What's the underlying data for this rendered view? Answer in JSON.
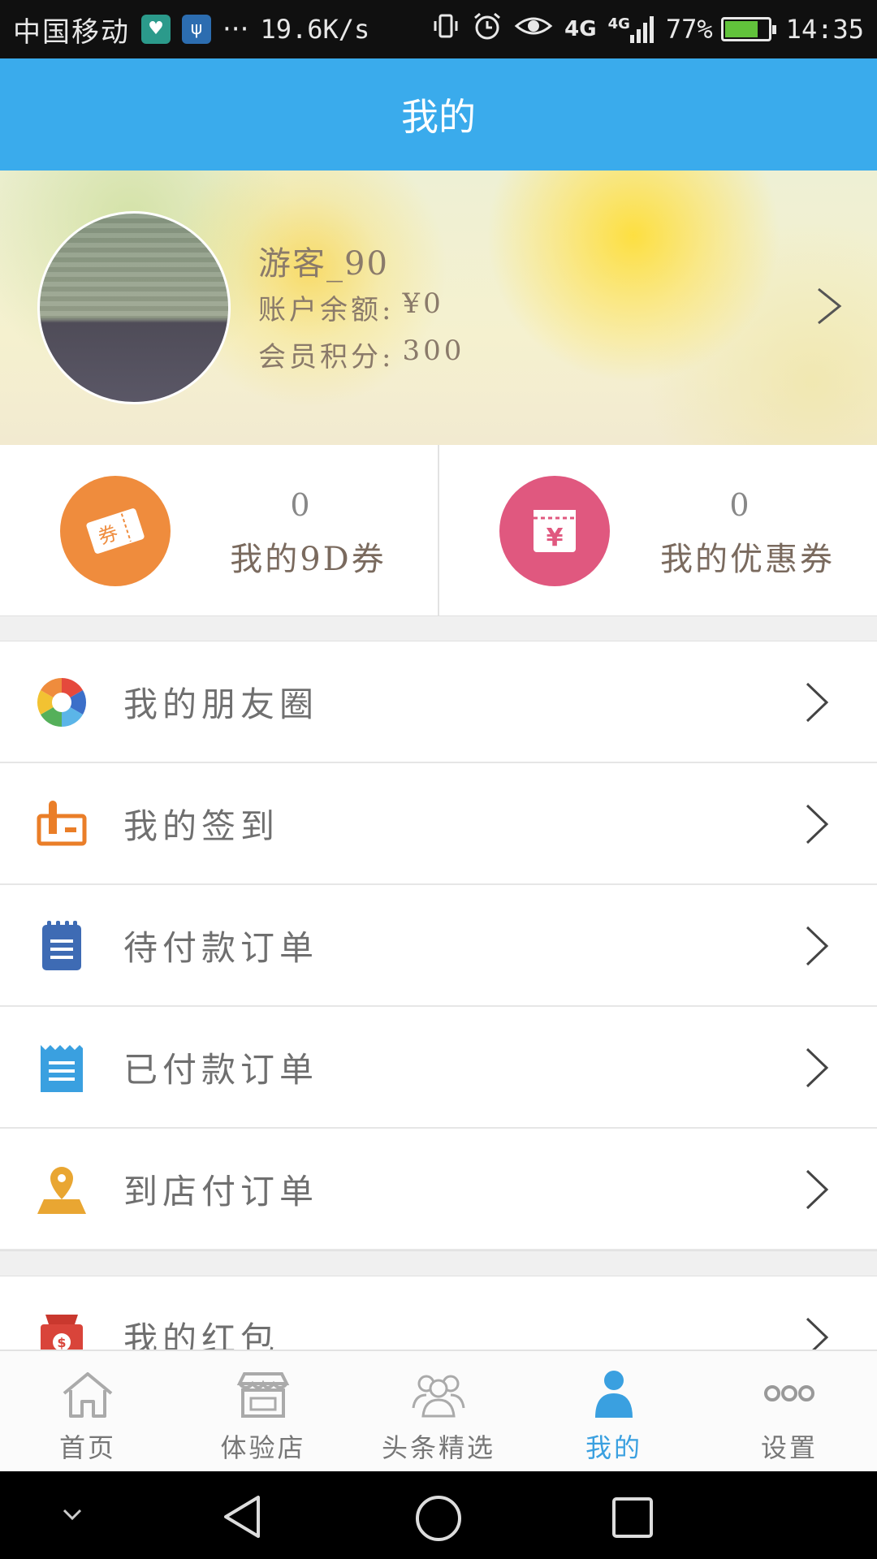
{
  "status_bar": {
    "carrier": "中国移动",
    "ellipsis": "···",
    "speed": "19.6K/s",
    "network_1": "4G",
    "network_2": "4G",
    "battery": "77%",
    "battery_level": 0.77,
    "time": "14:35"
  },
  "header": {
    "title": "我的"
  },
  "profile": {
    "username": "游客_90",
    "balance_label": "账户余额:",
    "balance_value": "¥0",
    "points_label": "会员积分:",
    "points_value": "300"
  },
  "coupons": [
    {
      "count": "0",
      "label": "我的9D券",
      "icon": "ticket-icon",
      "icon_text": "券",
      "color": "#ef8c3d"
    },
    {
      "count": "0",
      "label": "我的优惠券",
      "icon": "yen-coupon-icon",
      "icon_text": "¥",
      "color": "#e0587f"
    }
  ],
  "menu": [
    {
      "label": "我的朋友圈",
      "icon": "camera-aperture-icon"
    },
    {
      "label": "我的签到",
      "icon": "check-in-icon"
    },
    {
      "label": "待付款订单",
      "icon": "notepad-icon"
    },
    {
      "label": "已付款订单",
      "icon": "receipt-icon"
    },
    {
      "label": "到店付订单",
      "icon": "location-pin-icon"
    },
    {
      "label": "我的红包",
      "icon": "money-bag-icon"
    }
  ],
  "bottom_nav": [
    {
      "label": "首页",
      "icon": "home-icon",
      "active": false
    },
    {
      "label": "体验店",
      "icon": "store-icon",
      "active": false
    },
    {
      "label": "头条精选",
      "icon": "people-icon",
      "active": false
    },
    {
      "label": "我的",
      "icon": "person-icon",
      "active": true
    },
    {
      "label": "设置",
      "icon": "more-dots-icon",
      "active": false
    }
  ],
  "colors": {
    "header": "#3aabec",
    "active_tab": "#3aa0e0",
    "separator": "#f0f0f0"
  }
}
